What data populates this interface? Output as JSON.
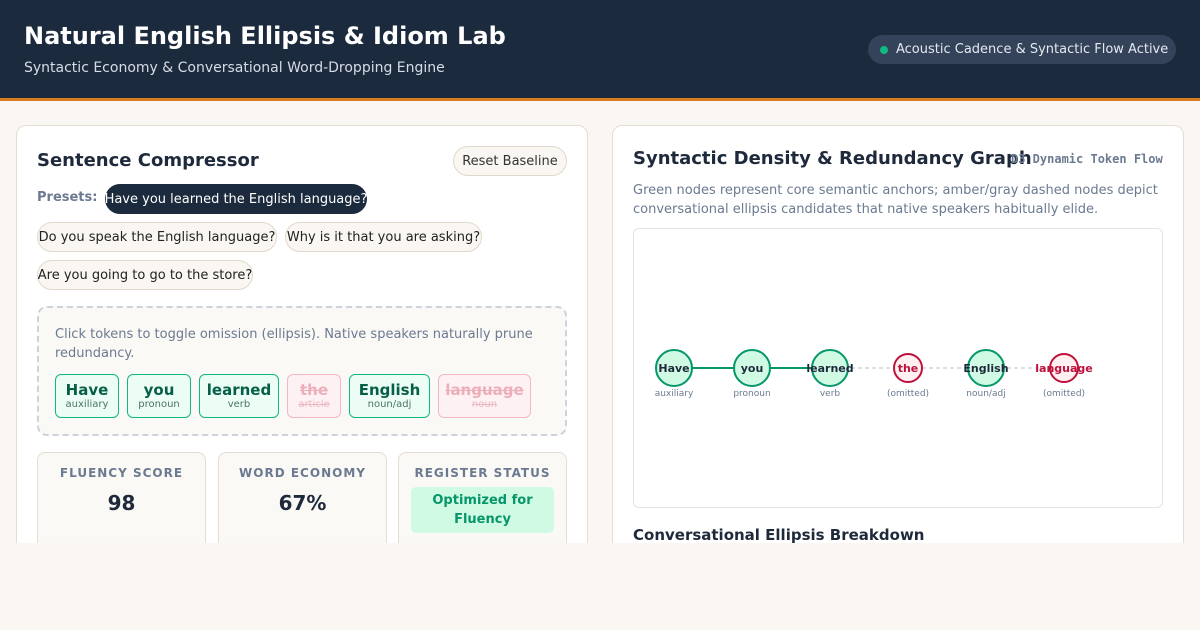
{
  "header": {
    "title": "Natural English Ellipsis & Idiom Lab",
    "subtitle": "Syntactic Economy & Conversational Word-Dropping Engine",
    "status": "Acoustic Cadence & Syntactic Flow Active",
    "status_color": "#10b981"
  },
  "compressor": {
    "title": "Sentence Compressor",
    "reset_label": "Reset Baseline",
    "presets_label": "Presets:",
    "presets": [
      "Have you learned the English language?",
      "Do you speak the English language?",
      "Why is it that you are asking?",
      "Are you going to go to the store?"
    ],
    "instructions": "Click tokens to toggle omission (ellipsis). Native speakers naturally prune redundancy.",
    "tokens": [
      {
        "word": "Have",
        "pos": "auxiliary",
        "omitted": false
      },
      {
        "word": "you",
        "pos": "pronoun",
        "omitted": false
      },
      {
        "word": "learned",
        "pos": "verb",
        "omitted": false
      },
      {
        "word": "the",
        "pos": "article",
        "omitted": true
      },
      {
        "word": "English",
        "pos": "noun/adj",
        "omitted": false
      },
      {
        "word": "language",
        "pos": "noun",
        "omitted": true
      }
    ],
    "stats": {
      "fluency_label": "FLUENCY SCORE",
      "fluency_value": "98",
      "economy_label": "WORD ECONOMY",
      "economy_value": "67%",
      "register_label": "REGISTER STATUS",
      "register_value": "Optimized for Fluency"
    }
  },
  "graph": {
    "title": "Syntactic Density & Redundancy Graph",
    "tag": "D3 Dynamic Token Flow",
    "description": "Green nodes represent core semantic anchors; amber/gray dashed nodes depict conversational ellipsis candidates that native speakers habitually elide.",
    "nodes": [
      {
        "word": "Have",
        "label": "auxiliary",
        "omitted": false
      },
      {
        "word": "you",
        "label": "pronoun",
        "omitted": false
      },
      {
        "word": "learned",
        "label": "verb",
        "omitted": false
      },
      {
        "word": "the",
        "label": "(omitted)",
        "omitted": true
      },
      {
        "word": "English",
        "label": "noun/adj",
        "omitted": false
      },
      {
        "word": "language",
        "label": "(omitted)",
        "omitted": true
      }
    ],
    "colors": {
      "kept": "#059669",
      "omitted": "#be123c",
      "kept_fill": "#d1fae5",
      "omitted_fill": "#fff1f2"
    },
    "breakdown_title": "Conversational Ellipsis Breakdown"
  }
}
